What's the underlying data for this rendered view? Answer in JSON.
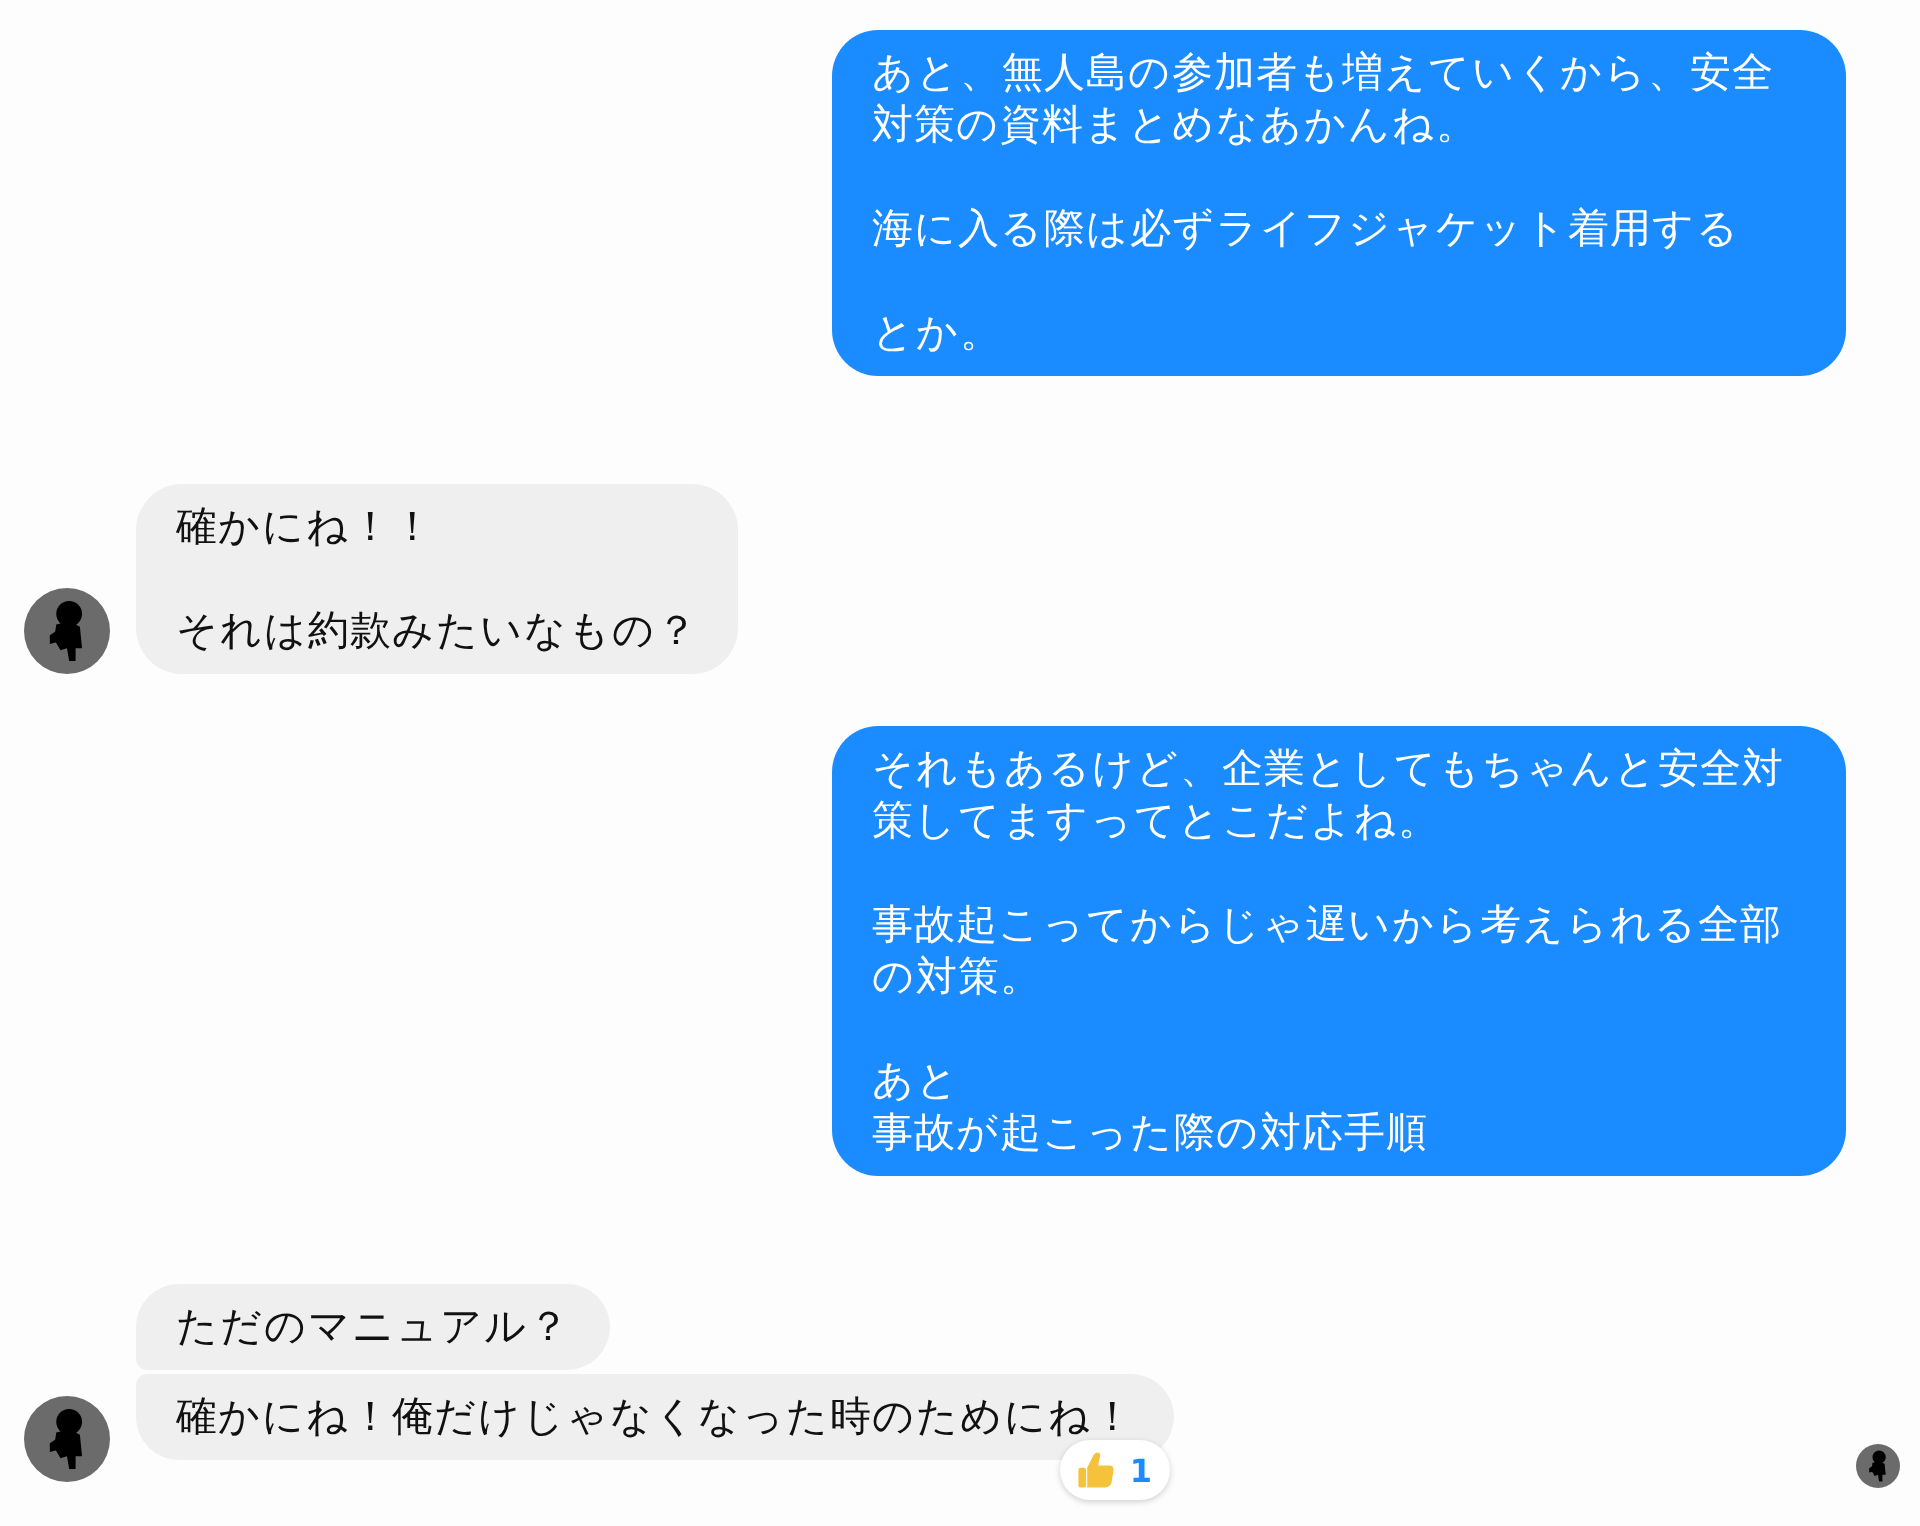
{
  "messages": [
    {
      "kind": "outgoing",
      "bubbles": [
        {
          "paragraphs": [
            [
              "あと、無人島の参加者も増えていくから、安全対策の資料まとめなあかんね。"
            ],
            [
              "海に入る際は必ずライフジャケット着用する"
            ],
            [
              "とか。"
            ]
          ]
        }
      ]
    },
    {
      "kind": "incoming",
      "bubbles": [
        {
          "paragraphs": [
            [
              "確かにね！！"
            ],
            [
              "それは約款みたいなもの？"
            ]
          ]
        }
      ]
    },
    {
      "kind": "outgoing",
      "bubbles": [
        {
          "paragraphs": [
            [
              "それもあるけど、企業としてもちゃんと安全対策してますってとこだよね。"
            ],
            [
              "事故起こってからじゃ遅いから考えられる全部の対策。"
            ],
            [
              "あと",
              "事故が起こった際の対応手順"
            ]
          ]
        }
      ]
    },
    {
      "kind": "incoming",
      "bubbles": [
        {
          "paragraphs": [
            [
              "ただのマニュアル？"
            ]
          ]
        },
        {
          "paragraphs": [
            [
              "確かにね！俺だけじゃなくなった時のためにね！"
            ]
          ],
          "reaction": {
            "count": "1"
          }
        }
      ]
    }
  ],
  "seen": true
}
